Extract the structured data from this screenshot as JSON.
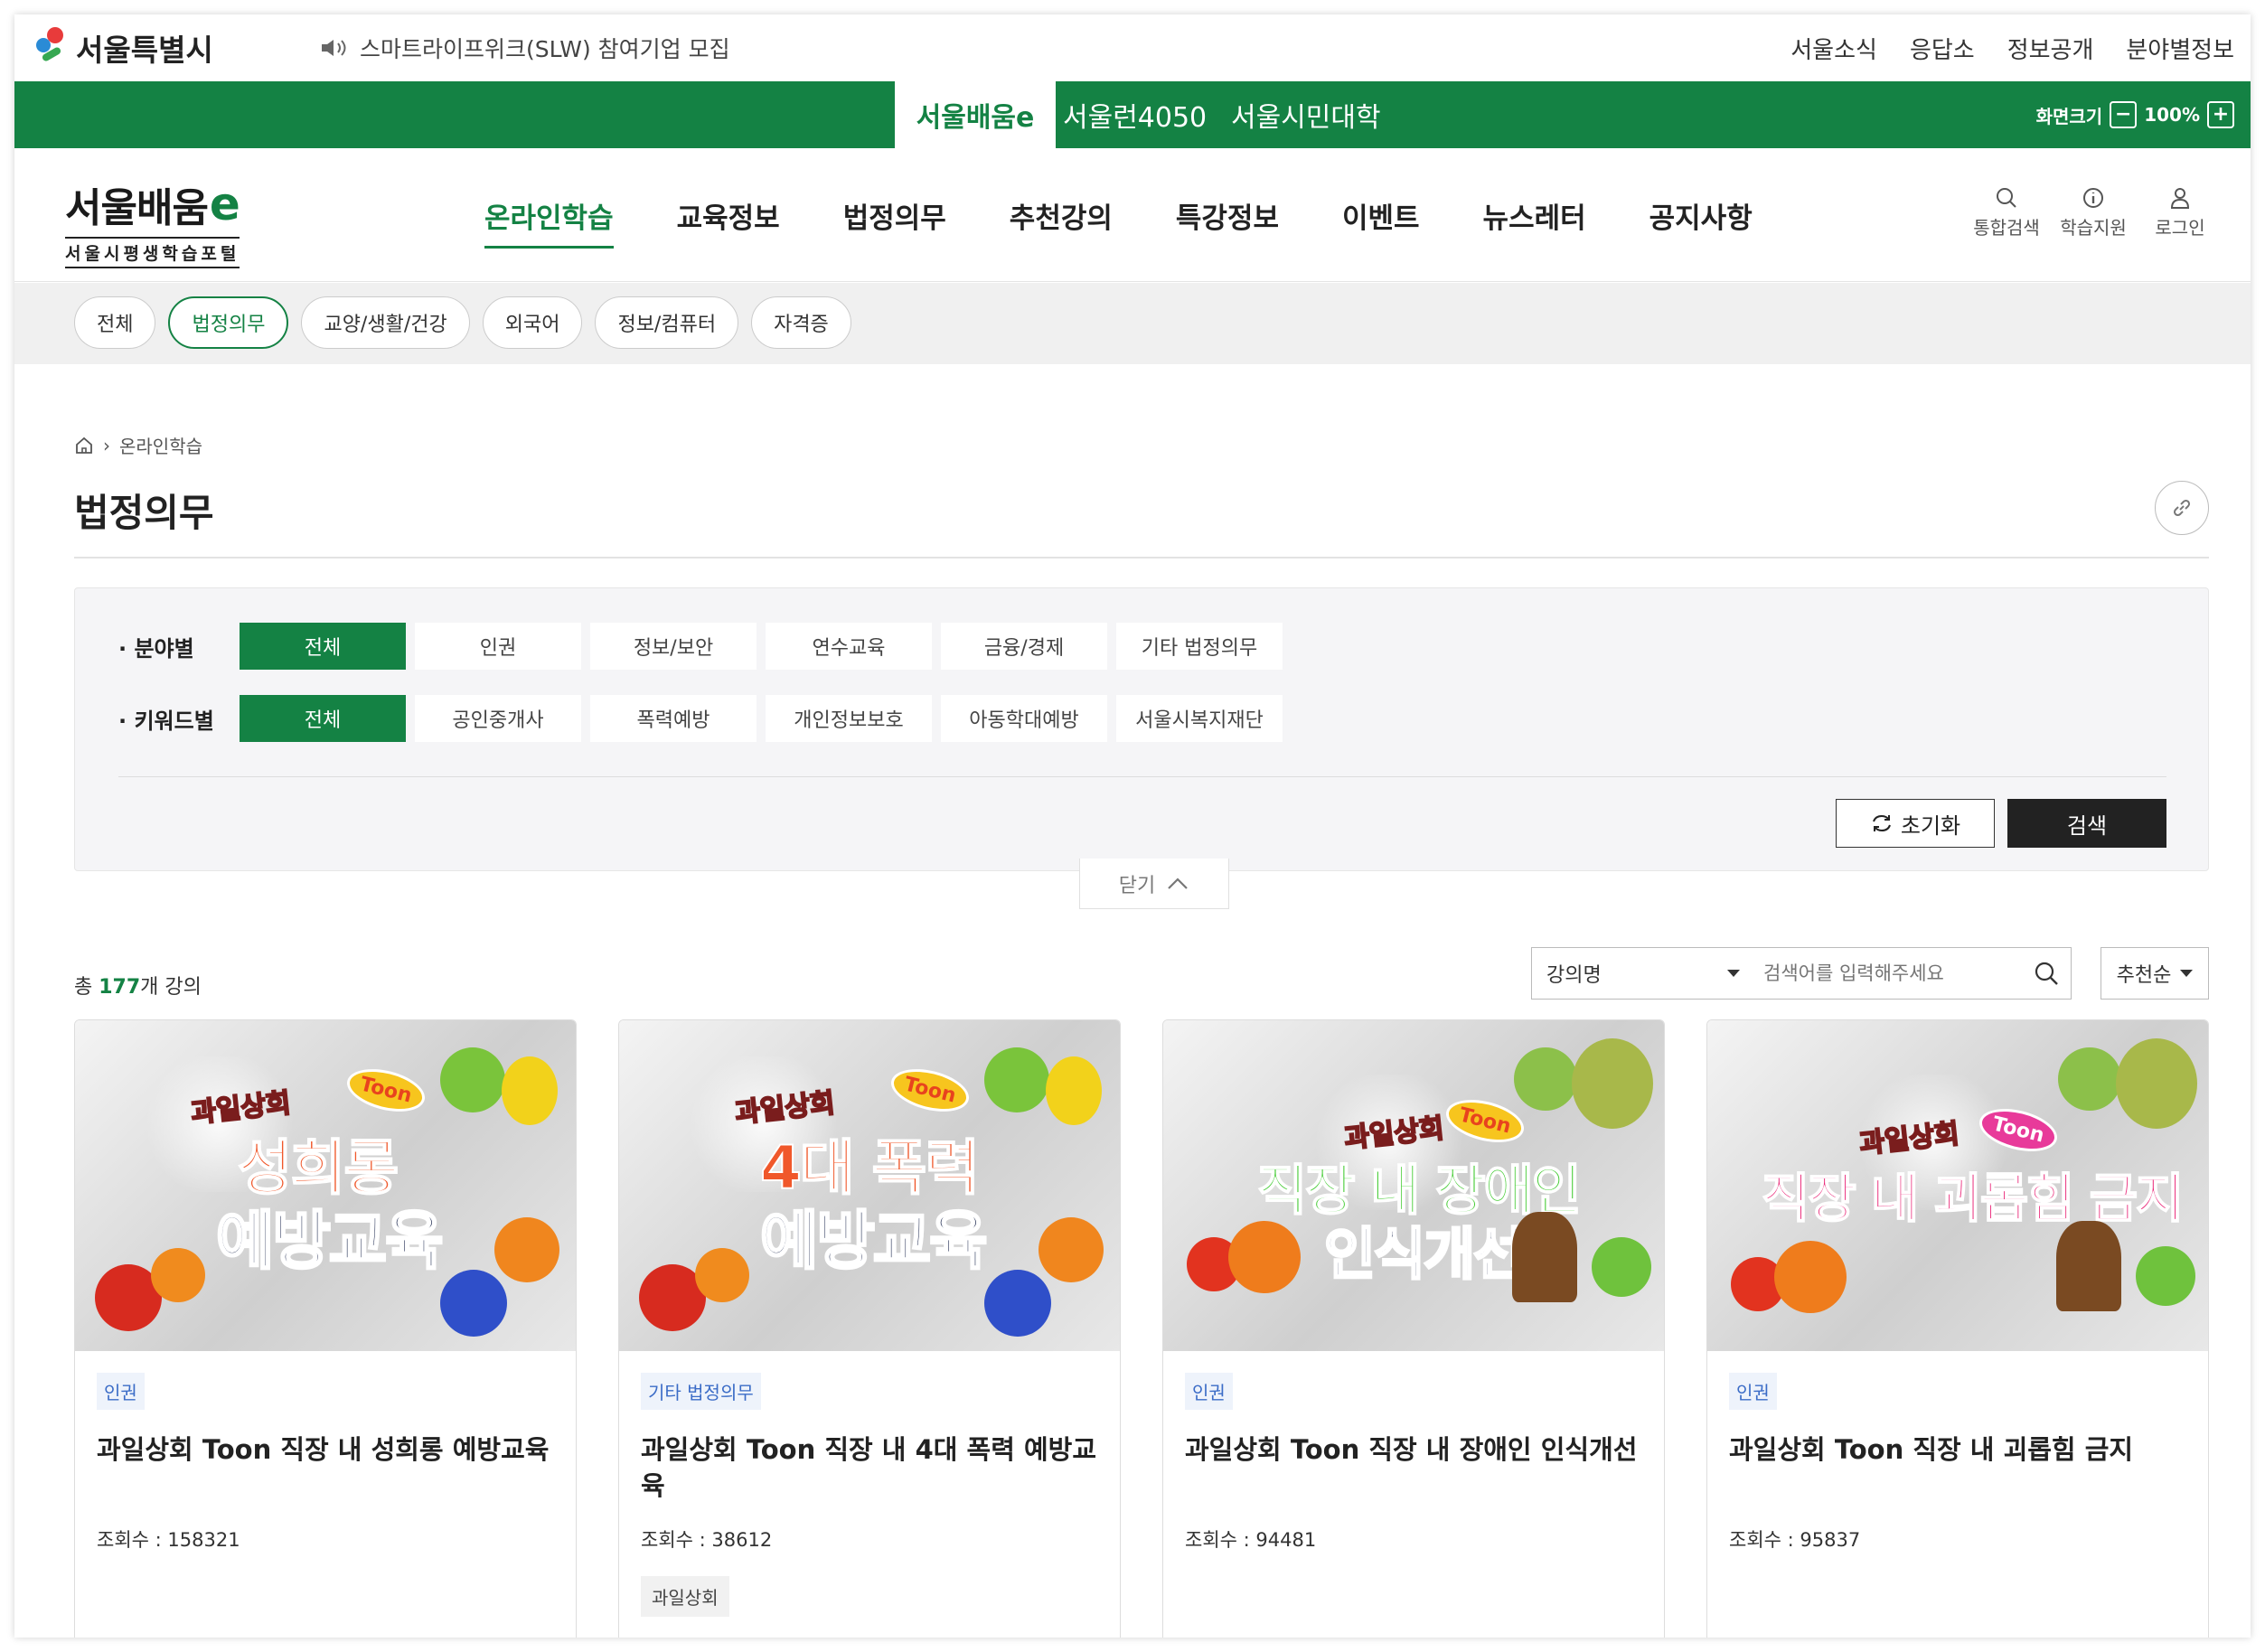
{
  "util": {
    "logo_text": "서울특별시",
    "notice": "스마트라이프위크(SLW) 참여기업 모집",
    "links": [
      "서울소식",
      "응답소",
      "정보공개",
      "분야별정보"
    ]
  },
  "greenbar": {
    "tabs": [
      "서울배움e",
      "서울런4050",
      "서울시민대학"
    ],
    "zoom_label": "화면크기",
    "zoom_value": "100%",
    "zoom_minus": "−",
    "zoom_plus": "+"
  },
  "header": {
    "brand_name": "서울배움",
    "brand_e": "e",
    "brand_sub": "서울시평생학습포털",
    "gnb": [
      "온라인학습",
      "교육정보",
      "법정의무",
      "추천강의",
      "특강정보",
      "이벤트",
      "뉴스레터",
      "공지사항"
    ],
    "icons": {
      "search": "통합검색",
      "support": "학습지원",
      "login": "로그인"
    }
  },
  "categories": [
    "전체",
    "법정의무",
    "교양/생활/건강",
    "외국어",
    "정보/컴퓨터",
    "자격증"
  ],
  "breadcrumb": {
    "current": "온라인학습"
  },
  "page_title": "법정의무",
  "filter": {
    "field_label": "· 분야별",
    "field_options": [
      "전체",
      "인권",
      "정보/보안",
      "연수교육",
      "금융/경제",
      "기타 법정의무"
    ],
    "keyword_label": "· 키워드별",
    "keyword_options": [
      "전체",
      "공인중개사",
      "폭력예방",
      "개인정보보호",
      "아동학대예방",
      "서울시복지재단"
    ],
    "reset": "초기화",
    "search": "검색",
    "close": "닫기"
  },
  "list": {
    "total_prefix": "총 ",
    "total_count": "177",
    "total_suffix": "개 강의",
    "search_type": "강의명",
    "search_placeholder": "검색어를 입력해주세요",
    "sort": "추천순"
  },
  "cards": [
    {
      "thumb_small": "과일상회",
      "thumb_toon": "Toon",
      "thumb_line1": "성희롱",
      "thumb_line2": "예방교육",
      "badge": "인권",
      "title": "과일상회 Toon 직장 내 성희롱 예방교육",
      "views": "조회수 : 158321",
      "tag": ""
    },
    {
      "thumb_small": "과일상회",
      "thumb_toon": "Toon",
      "thumb_line1": "4대 폭력",
      "thumb_line2": "예방교육",
      "badge": "기타 법정의무",
      "title": "과일상회 Toon 직장 내 4대 폭력 예방교육",
      "views": "조회수 : 38612",
      "tag": "과일상회"
    },
    {
      "thumb_small": "과일상회",
      "thumb_toon": "Toon",
      "thumb_line1": "직장 내 장애인",
      "thumb_line2": "인식개선",
      "badge": "인권",
      "title": "과일상회 Toon 직장 내 장애인 인식개선",
      "views": "조회수 : 94481",
      "tag": ""
    },
    {
      "thumb_small": "과일상회",
      "thumb_toon": "Toon",
      "thumb_line1": "직장 내 괴롭힘 금지",
      "thumb_line2": "",
      "badge": "인권",
      "title": "과일상회 Toon 직장 내 괴롭힘 금지",
      "views": "조회수 : 95837",
      "tag": ""
    }
  ],
  "colors": {
    "brand_green": "#148244",
    "badge_blue": "#3b6cc7",
    "dark_button": "#222222"
  }
}
